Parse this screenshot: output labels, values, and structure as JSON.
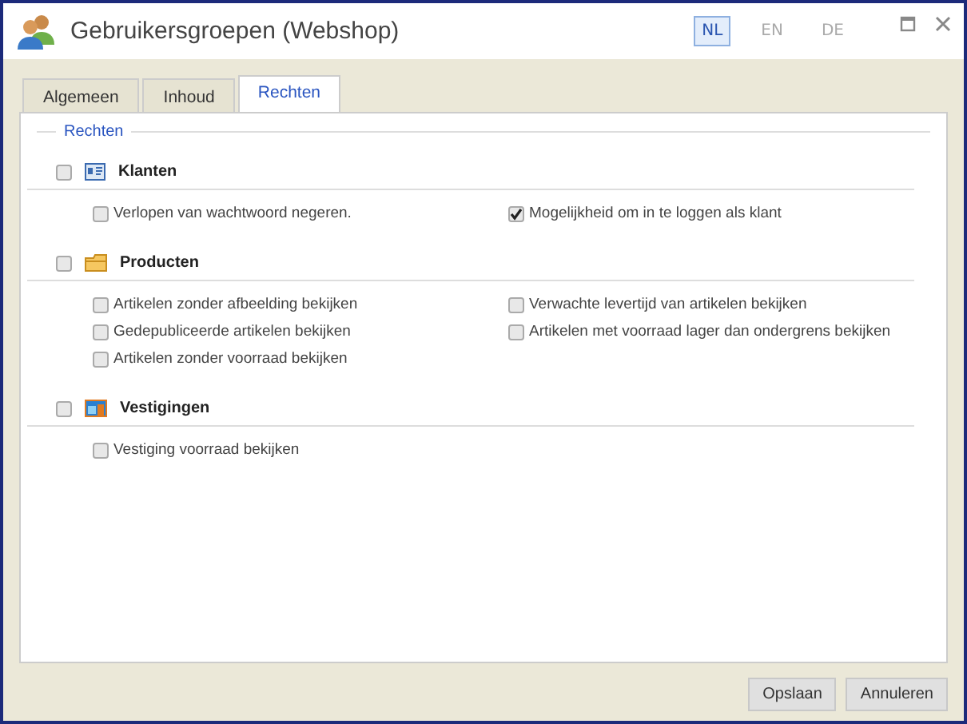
{
  "window": {
    "title": "Gebruikersgroepen (Webshop)"
  },
  "languages": [
    {
      "label": "NL",
      "selected": true
    },
    {
      "label": "EN",
      "selected": false
    },
    {
      "label": "DE",
      "selected": false
    }
  ],
  "tabs": [
    {
      "label": "Algemeen",
      "selected": false
    },
    {
      "label": "Inhoud",
      "selected": false
    },
    {
      "label": "Rechten",
      "selected": true
    }
  ],
  "fieldset": {
    "legend": "Rechten"
  },
  "sections": [
    {
      "title": "Klanten",
      "kind": "customers",
      "checked": false,
      "items": [
        {
          "label": "Verlopen van wachtwoord negeren.",
          "checked": false
        },
        {
          "label": "Mogelijkheid om in te loggen als klant",
          "checked": true
        }
      ]
    },
    {
      "title": "Producten",
      "kind": "products",
      "checked": false,
      "items": [
        {
          "label": "Artikelen zonder afbeelding bekijken",
          "checked": false
        },
        {
          "label": "Verwachte levertijd van artikelen bekijken",
          "checked": false
        },
        {
          "label": "Gedepubliceerde artikelen bekijken",
          "checked": false
        },
        {
          "label": "Artikelen met voorraad lager dan ondergrens bekijken",
          "checked": false
        },
        {
          "label": "Artikelen zonder voorraad bekijken",
          "checked": false
        }
      ]
    },
    {
      "title": "Vestigingen",
      "kind": "locations",
      "checked": false,
      "items": [
        {
          "label": "Vestiging voorraad bekijken",
          "checked": false
        }
      ]
    }
  ],
  "buttons": [
    "Opslaan",
    "Annuleren"
  ]
}
